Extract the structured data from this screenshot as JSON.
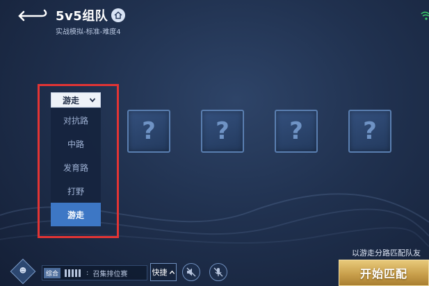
{
  "header": {
    "title": "5v5组队",
    "subtitle": "实战模拟-标准-难度4",
    "back_icon": "back-arrow-icon",
    "home_icon": "home-icon",
    "signal_icon": "wifi-icon"
  },
  "lane_dropdown": {
    "selected": "游走",
    "options": [
      "对抗路",
      "中路",
      "发育路",
      "打野",
      "游走"
    ],
    "selected_index": 4
  },
  "slots": [
    {
      "label": "?"
    },
    {
      "label": "?"
    },
    {
      "label": "?"
    },
    {
      "label": "?"
    },
    {
      "label": "?"
    }
  ],
  "bottom": {
    "match_hint": "以游走分路匹配队友",
    "start_button": "开始匹配",
    "chat_tag": "综合",
    "chat_text": "召集排位赛",
    "quick_button": "快捷",
    "speaker_muted_icon": "speaker-muted-icon",
    "mic_muted_icon": "mic-muted-icon"
  },
  "colors": {
    "highlight": "#e33434",
    "selected": "#3d77c5",
    "start_button": "#c9a04c"
  }
}
